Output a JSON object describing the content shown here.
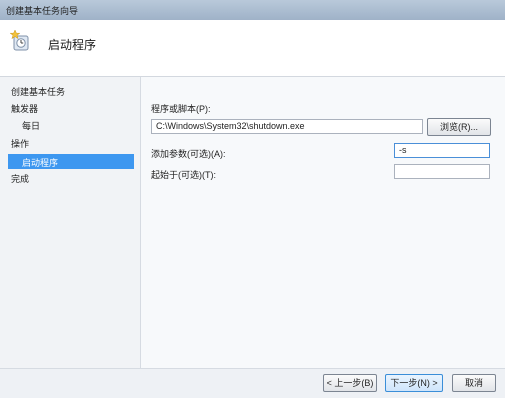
{
  "window": {
    "title": "创建基本任务向导"
  },
  "header": {
    "title": "启动程序",
    "icon": "clock-star-icon"
  },
  "sidebar": {
    "items": [
      {
        "label": "创建基本任务"
      },
      {
        "label": "触发器"
      },
      {
        "label": "每日"
      },
      {
        "label": "操作"
      },
      {
        "label": "启动程序"
      },
      {
        "label": "完成"
      }
    ]
  },
  "form": {
    "program_label": "程序或脚本(P):",
    "program_value": "C:\\Windows\\System32\\shutdown.exe",
    "browse_label": "浏览(R)...",
    "args_label": "添加参数(可选)(A):",
    "args_value": "-s",
    "start_label": "起始于(可选)(T):",
    "start_value": ""
  },
  "buttons": {
    "back": "< 上一步(B)",
    "next": "下一步(N) >",
    "cancel": "取消"
  }
}
